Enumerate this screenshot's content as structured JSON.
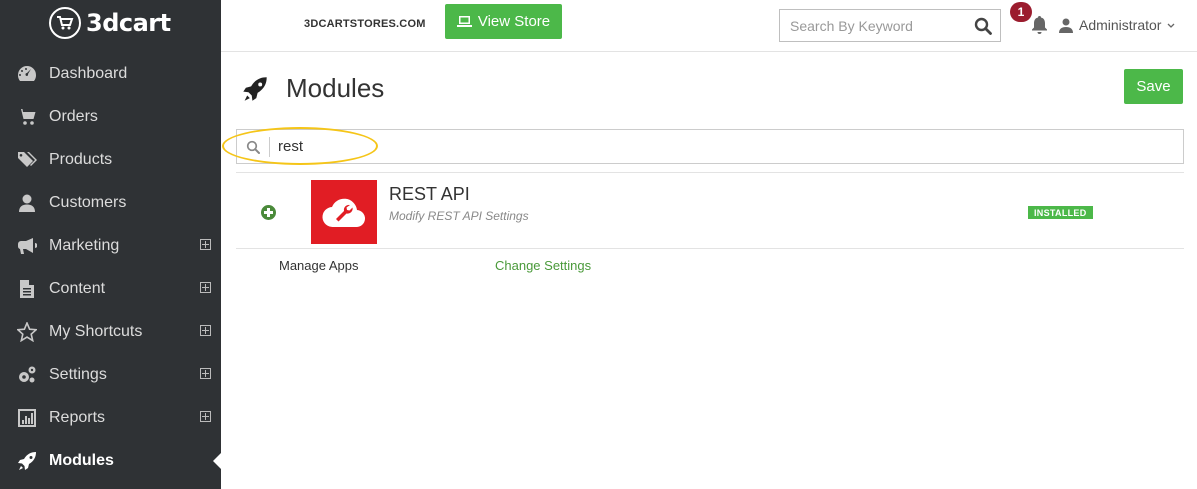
{
  "brand": {
    "logo_text": "3dcart"
  },
  "topbar": {
    "store_domain": "3DCARTSTORES.COM",
    "view_store_label": "View Store",
    "search_placeholder": "Search By Keyword",
    "notification_count": "1",
    "user_name": "Administrator"
  },
  "sidebar": {
    "items": [
      {
        "label": "Dashboard",
        "icon": "dashboard-icon",
        "expandable": false
      },
      {
        "label": "Orders",
        "icon": "cart-icon",
        "expandable": false
      },
      {
        "label": "Products",
        "icon": "tags-icon",
        "expandable": false
      },
      {
        "label": "Customers",
        "icon": "user-icon",
        "expandable": false
      },
      {
        "label": "Marketing",
        "icon": "bullhorn-icon",
        "expandable": true
      },
      {
        "label": "Content",
        "icon": "file-icon",
        "expandable": true
      },
      {
        "label": "My Shortcuts",
        "icon": "star-icon",
        "expandable": true
      },
      {
        "label": "Settings",
        "icon": "gears-icon",
        "expandable": true
      },
      {
        "label": "Reports",
        "icon": "bar-chart-icon",
        "expandable": true
      },
      {
        "label": "Modules",
        "icon": "rocket-icon",
        "expandable": false,
        "active": true
      }
    ]
  },
  "page": {
    "title": "Modules",
    "save_label": "Save",
    "filter_value": "rest"
  },
  "modules": [
    {
      "name": "REST API",
      "description": "Modify REST API Settings",
      "status": "INSTALLED"
    }
  ],
  "footer_links": {
    "manage_apps": "Manage Apps",
    "change_settings": "Change Settings"
  },
  "colors": {
    "accent_green": "#4cb849",
    "sidebar_bg": "#2f3235",
    "badge_red": "#9b1c2e",
    "module_red": "#e11d24",
    "highlight_yellow": "#f5c518"
  }
}
